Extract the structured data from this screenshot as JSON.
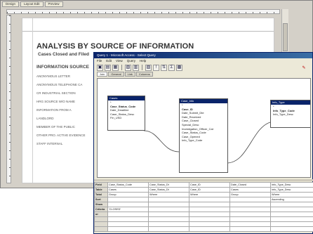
{
  "report_window": {
    "tabs": [
      "Design",
      "Layout Edit",
      "Preview"
    ]
  },
  "report": {
    "title": "ANALYSIS BY SOURCE OF INFORMATION",
    "subtitle": "Cases Closed and Filed",
    "column_header": "INFORMATION SOURCE",
    "rows": [
      "ANONYMOUS LETTER",
      "ANONYMOUS TELEPHONE CA",
      "CR INDUSTRIAL SECTION",
      "HRG SOURCE W/O NAME",
      "INFORMATION FROM A",
      "LANDLORD",
      "MEMBER OF THE PUBLIC",
      "OTHER PRO. ACTIVE EVIDENCE",
      "STAFF INTERNAL"
    ]
  },
  "query_window": {
    "title": "Query 1 - Microsoft Access - Select Query",
    "menu": [
      "File",
      "Edit",
      "View",
      "Query",
      "Help"
    ],
    "toolbar": [
      {
        "icon": "save-icon",
        "glyph": "▣"
      },
      {
        "icon": "new-icon",
        "glyph": "▤"
      },
      {
        "icon": "print-icon",
        "glyph": "▦"
      },
      {
        "icon": "properties-icon",
        "glyph": "▧"
      },
      {
        "icon": "table-icon",
        "glyph": "▥"
      },
      {
        "icon": "join-icon",
        "glyph": "▨"
      },
      {
        "icon": "run-icon",
        "glyph": "!"
      },
      {
        "icon": "sort-icon",
        "glyph": "⇅"
      },
      {
        "icon": "totals-icon",
        "glyph": "Σ"
      },
      {
        "icon": "view-icon",
        "glyph": "▩"
      }
    ],
    "pin_glyph": "✎",
    "tabs": [
      "Join",
      "General",
      "Link",
      "Columns"
    ],
    "tables": [
      {
        "name": "Cases",
        "fields": [
          "*",
          "Case_Status_Code",
          "Date_Deadline",
          "Case_Status_Desc",
          "Fin_USD"
        ]
      },
      {
        "name": "Case_Info",
        "fields": [
          "*",
          "Case_ID",
          "Date_Submit_Dte",
          "Date_Received",
          "Case_Closed",
          "Special_Desc",
          "Investigation_Officer_Cat",
          "Case_Status_Code",
          "Case_Opened",
          "Info_Type_Code"
        ]
      },
      {
        "name": "Info_Type",
        "fields": [
          "*",
          "Info_Type_Code",
          "Info_Type_Desc"
        ]
      }
    ],
    "grid": {
      "columns": [
        "Case_Status_Code",
        "Case_Status_Dt",
        "Case_ID",
        "Date_Closed",
        "Info_Type_Desc"
      ],
      "rows": [
        {
          "label": "Field",
          "cells": [
            "Case_Status_Code",
            "Case_Status_Dt",
            "Case_ID",
            "Date_Closed",
            "Info_Type_Desc"
          ]
        },
        {
          "label": "Table",
          "cells": [
            "Cases",
            "Case_Status_Dt",
            "Case_ID",
            "Cases",
            "Info_Type_Desc"
          ]
        },
        {
          "label": "Total",
          "cells": [
            "Group",
            "Where",
            "Where",
            "Group",
            "Where"
          ]
        },
        {
          "label": "Sort",
          "cells": [
            "",
            "",
            "",
            "",
            "Ascending"
          ]
        },
        {
          "label": "Show",
          "cells": [
            "",
            "",
            "",
            "",
            ""
          ]
        },
        {
          "label": "Criteria",
          "cells": [
            "'CLOSED'",
            "",
            "",
            "",
            ""
          ]
        },
        {
          "label": "or",
          "cells": [
            "",
            "",
            "",
            "",
            ""
          ]
        },
        {
          "label": "",
          "cells": [
            "",
            "",
            "",
            "",
            ""
          ]
        },
        {
          "label": "",
          "cells": [
            "",
            "",
            "",
            "",
            ""
          ]
        },
        {
          "label": "",
          "cells": [
            "",
            "",
            "",
            "",
            ""
          ]
        }
      ]
    }
  },
  "colors": {
    "title_bar": "#0a246a",
    "window_bg": "#ece9d8",
    "report_bg": "#d4d0c8"
  }
}
